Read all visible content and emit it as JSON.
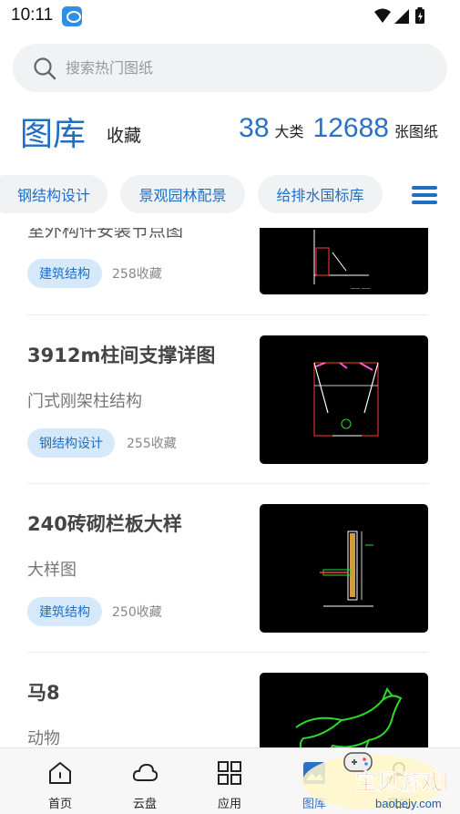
{
  "status_bar": {
    "time": "10:11"
  },
  "search": {
    "placeholder": "搜索热门图纸"
  },
  "library": {
    "title": "图库",
    "favorites_label": "收藏",
    "category_count": "38",
    "category_unit": "大类",
    "drawing_count": "12688",
    "drawing_unit": "张图纸"
  },
  "categories": [
    "钢结构设计",
    "景观园林配景",
    "给排水国标库"
  ],
  "items": [
    {
      "title": "室外构件安装节点图",
      "tag": "建筑结构",
      "favorites": "258收藏"
    },
    {
      "title": "3912m柱间支撑详图",
      "subtitle": "门式刚架柱结构",
      "tag": "钢结构设计",
      "favorites": "255收藏"
    },
    {
      "title": "240砖砌栏板大样",
      "subtitle": "大样图",
      "tag": "建筑结构",
      "favorites": "250收藏"
    },
    {
      "title": "马8",
      "subtitle": "动物"
    }
  ],
  "bottom_nav": [
    {
      "label": "首页",
      "icon": "home-icon"
    },
    {
      "label": "云盘",
      "icon": "cloud-icon"
    },
    {
      "label": "应用",
      "icon": "grid-icon"
    },
    {
      "label": "图库",
      "icon": "gallery-icon",
      "active": true
    },
    {
      "label": "我的",
      "icon": "profile-icon"
    }
  ],
  "watermark": {
    "text": "宝贝游戏网",
    "domain": "baobeiy.com"
  },
  "colors": {
    "accent": "#1f6fc5",
    "chip_bg": "#f1f2f4",
    "tag_bg": "#d6e9fa",
    "cad_green": "#2bdc2b",
    "cad_red": "#ff3b3b"
  }
}
